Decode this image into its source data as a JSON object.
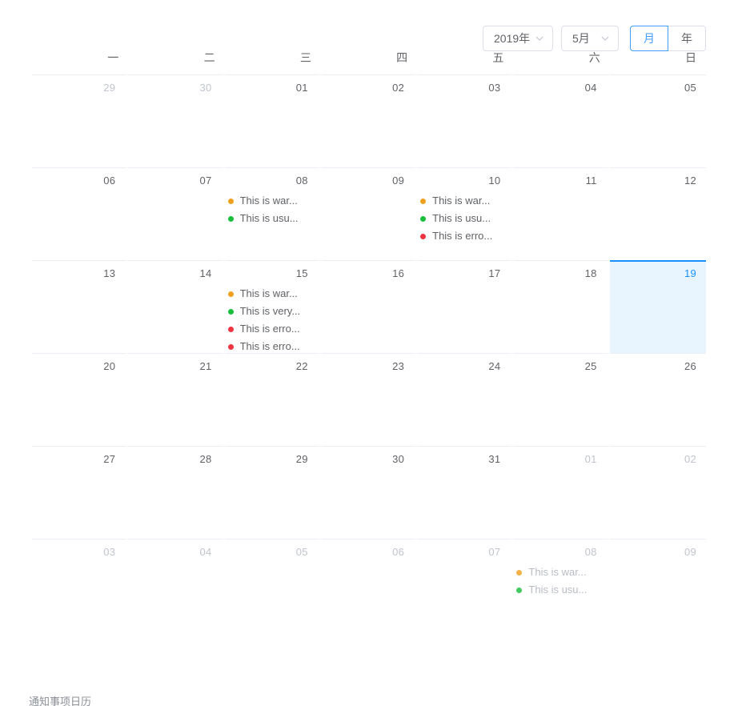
{
  "toolbar": {
    "year_select": {
      "value": "2019年",
      "icon": "chevron-down-icon"
    },
    "month_select": {
      "value": "5月",
      "icon": "chevron-down-icon"
    },
    "view_buttons": [
      {
        "label": "月",
        "active": true
      },
      {
        "label": "年",
        "active": false
      }
    ]
  },
  "weekdays": [
    "一",
    "二",
    "三",
    "四",
    "五",
    "六",
    "日"
  ],
  "footer": {
    "caption": "通知事项日历"
  },
  "colors": {
    "accent": "#409eff",
    "selected_border": "#1890ff",
    "selected_bg": "#e8f4fe",
    "text": "#606266",
    "muted_text": "#c0c4cc",
    "border": "#ebeef5",
    "warning": "#f0a020",
    "success": "#19be3c",
    "error": "#ef3340"
  },
  "weeks": [
    [
      {
        "day": "29",
        "other": true,
        "selected": false,
        "events": []
      },
      {
        "day": "30",
        "other": true,
        "selected": false,
        "events": []
      },
      {
        "day": "01",
        "other": false,
        "selected": false,
        "events": []
      },
      {
        "day": "02",
        "other": false,
        "selected": false,
        "events": []
      },
      {
        "day": "03",
        "other": false,
        "selected": false,
        "events": []
      },
      {
        "day": "04",
        "other": false,
        "selected": false,
        "events": []
      },
      {
        "day": "05",
        "other": false,
        "selected": false,
        "events": []
      }
    ],
    [
      {
        "day": "06",
        "other": false,
        "selected": false,
        "events": []
      },
      {
        "day": "07",
        "other": false,
        "selected": false,
        "events": []
      },
      {
        "day": "08",
        "other": false,
        "selected": false,
        "events": [
          {
            "type": "warning",
            "text": "This is war..."
          },
          {
            "type": "success",
            "text": "This is usu..."
          }
        ]
      },
      {
        "day": "09",
        "other": false,
        "selected": false,
        "events": []
      },
      {
        "day": "10",
        "other": false,
        "selected": false,
        "events": [
          {
            "type": "warning",
            "text": "This is war..."
          },
          {
            "type": "success",
            "text": "This is usu..."
          },
          {
            "type": "error",
            "text": "This is erro..."
          }
        ]
      },
      {
        "day": "11",
        "other": false,
        "selected": false,
        "events": []
      },
      {
        "day": "12",
        "other": false,
        "selected": false,
        "events": []
      }
    ],
    [
      {
        "day": "13",
        "other": false,
        "selected": false,
        "events": []
      },
      {
        "day": "14",
        "other": false,
        "selected": false,
        "events": []
      },
      {
        "day": "15",
        "other": false,
        "selected": false,
        "events": [
          {
            "type": "warning",
            "text": "This is war..."
          },
          {
            "type": "success",
            "text": "This is very..."
          },
          {
            "type": "error",
            "text": "This is erro..."
          },
          {
            "type": "error",
            "text": "This is erro..."
          }
        ]
      },
      {
        "day": "16",
        "other": false,
        "selected": false,
        "events": []
      },
      {
        "day": "17",
        "other": false,
        "selected": false,
        "events": []
      },
      {
        "day": "18",
        "other": false,
        "selected": false,
        "events": []
      },
      {
        "day": "19",
        "other": false,
        "selected": true,
        "events": []
      }
    ],
    [
      {
        "day": "20",
        "other": false,
        "selected": false,
        "events": []
      },
      {
        "day": "21",
        "other": false,
        "selected": false,
        "events": []
      },
      {
        "day": "22",
        "other": false,
        "selected": false,
        "events": []
      },
      {
        "day": "23",
        "other": false,
        "selected": false,
        "events": []
      },
      {
        "day": "24",
        "other": false,
        "selected": false,
        "events": []
      },
      {
        "day": "25",
        "other": false,
        "selected": false,
        "events": []
      },
      {
        "day": "26",
        "other": false,
        "selected": false,
        "events": []
      }
    ],
    [
      {
        "day": "27",
        "other": false,
        "selected": false,
        "events": []
      },
      {
        "day": "28",
        "other": false,
        "selected": false,
        "events": []
      },
      {
        "day": "29",
        "other": false,
        "selected": false,
        "events": []
      },
      {
        "day": "30",
        "other": false,
        "selected": false,
        "events": []
      },
      {
        "day": "31",
        "other": false,
        "selected": false,
        "events": []
      },
      {
        "day": "01",
        "other": true,
        "selected": false,
        "events": []
      },
      {
        "day": "02",
        "other": true,
        "selected": false,
        "events": []
      }
    ],
    [
      {
        "day": "03",
        "other": true,
        "selected": false,
        "events": []
      },
      {
        "day": "04",
        "other": true,
        "selected": false,
        "events": []
      },
      {
        "day": "05",
        "other": true,
        "selected": false,
        "events": []
      },
      {
        "day": "06",
        "other": true,
        "selected": false,
        "events": []
      },
      {
        "day": "07",
        "other": true,
        "selected": false,
        "events": []
      },
      {
        "day": "08",
        "other": true,
        "selected": false,
        "events": [
          {
            "type": "warning",
            "text": "This is war..."
          },
          {
            "type": "success",
            "text": "This is usu..."
          }
        ]
      },
      {
        "day": "09",
        "other": true,
        "selected": false,
        "events": []
      }
    ]
  ]
}
